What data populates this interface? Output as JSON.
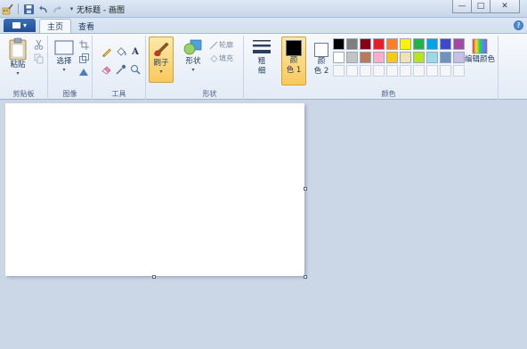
{
  "window": {
    "title": "无标题 - 画图",
    "minimize_glyph": "—",
    "maximize_glyph": "□",
    "close_glyph": "✕"
  },
  "tabs": {
    "home": "主页",
    "view": "查看",
    "help_glyph": "?"
  },
  "ribbon": {
    "clipboard": {
      "group": "剪贴板",
      "paste": "粘贴"
    },
    "image": {
      "group": "图像",
      "select": "选择"
    },
    "tools": {
      "group": "工具"
    },
    "brushes": {
      "label": "刷子"
    },
    "shapes": {
      "group": "形状",
      "shapes": "形状",
      "outline": "轮廓",
      "fill": "填充"
    },
    "size": {
      "label_line1": "粗",
      "label_line2": "细"
    },
    "colors": {
      "group": "颜色",
      "color1_line1": "颜",
      "color1_line2": "色 1",
      "color2_line1": "颜",
      "color2_line2": "色 2",
      "edit": "编辑颜色",
      "color1_value": "#000000",
      "color2_value": "#ffffff",
      "row1": [
        "#000000",
        "#7f7f7f",
        "#880015",
        "#ed1c24",
        "#ff7f27",
        "#fff200",
        "#22b14c",
        "#00a2e8",
        "#3f48cc",
        "#a349a4"
      ],
      "row2": [
        "#ffffff",
        "#c3c3c3",
        "#b97a57",
        "#ffaec9",
        "#ffc90e",
        "#efe4b0",
        "#b5e61d",
        "#99d9ea",
        "#7092be",
        "#c8bfe7"
      ],
      "row3": [
        "#f4f6f9",
        "#f4f6f9",
        "#f4f6f9",
        "#f4f6f9",
        "#f4f6f9",
        "#f4f6f9",
        "#f4f6f9",
        "#f4f6f9",
        "#f4f6f9",
        "#f4f6f9"
      ]
    }
  }
}
